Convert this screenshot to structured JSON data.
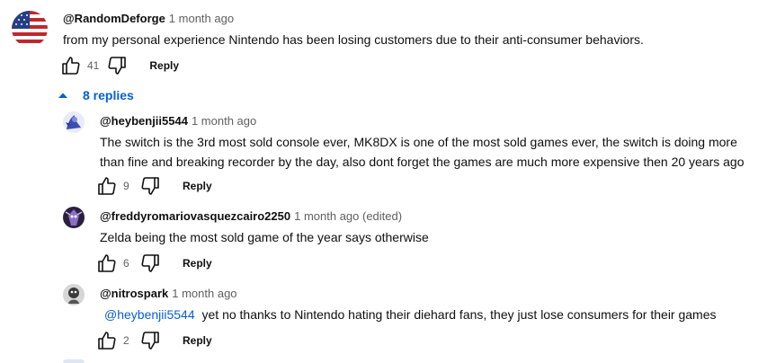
{
  "main_comment": {
    "author": "@RandomDeforge",
    "time": "1 month ago",
    "text": "from my personal experience Nintendo has been losing customers due to their anti-consumer behaviors.",
    "likes": "41",
    "reply_label": "Reply"
  },
  "replies_toggle": {
    "label": "8 replies"
  },
  "replies": [
    {
      "author": "@heybenjii5544",
      "time": "1 month ago",
      "text": "The switch is the 3rd most sold console ever, MK8DX is one of the most sold games ever, the switch is doing more than fine and breaking recorder by the day, also dont forget the games are much more expensive then 20 years ago",
      "likes": "9",
      "reply_label": "Reply"
    },
    {
      "author": "@freddyromariovasquezcairo2250",
      "time": "1 month ago (edited)",
      "text": "Zelda being the most sold game of the year says otherwise",
      "likes": "6",
      "reply_label": "Reply"
    },
    {
      "author": "@nitrospark",
      "time": "1 month ago",
      "mention": "@heybenjii5544",
      "text": "yet no thanks to Nintendo hating their diehard fans, they just lose consumers for their games",
      "likes": "2",
      "reply_label": "Reply"
    }
  ],
  "colors": {
    "link": "#065fd4",
    "secondary_text": "#606060",
    "primary_text": "#0f0f0f"
  }
}
